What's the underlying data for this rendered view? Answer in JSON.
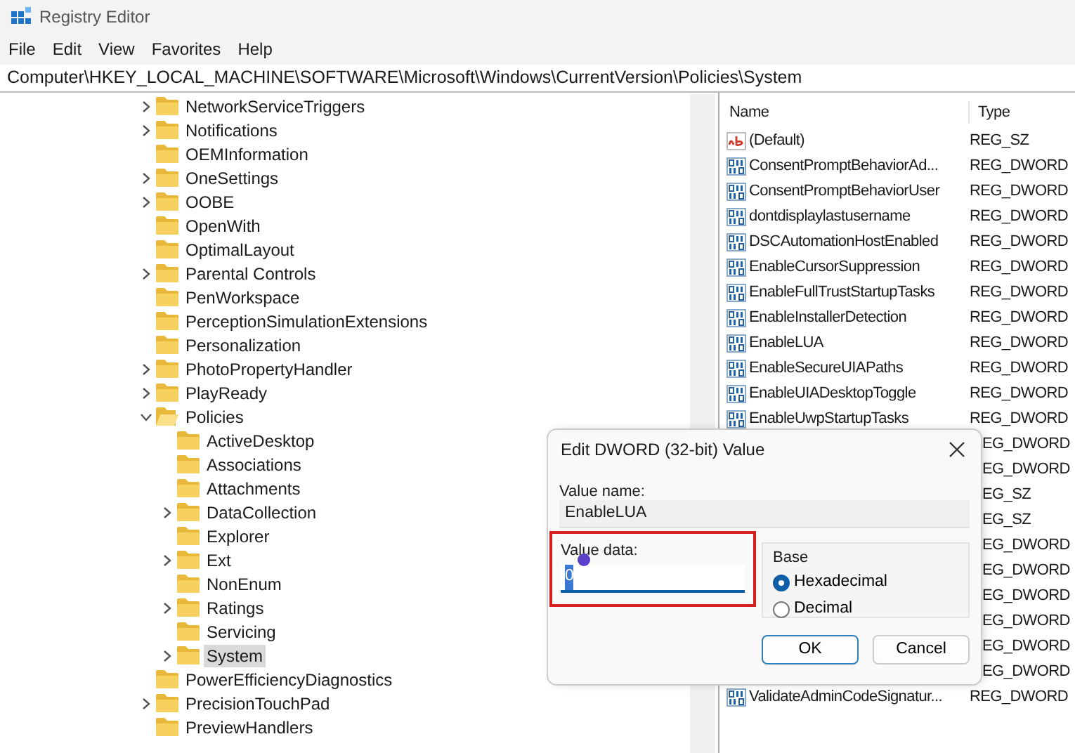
{
  "window": {
    "title": "Registry Editor"
  },
  "menu": [
    "File",
    "Edit",
    "View",
    "Favorites",
    "Help"
  ],
  "address": "Computer\\HKEY_LOCAL_MACHINE\\SOFTWARE\\Microsoft\\Windows\\CurrentVersion\\Policies\\System",
  "tree": [
    {
      "label": "NetworkServiceTriggers",
      "expandable": true,
      "expanded": false,
      "selected": false
    },
    {
      "label": "Notifications",
      "expandable": true,
      "expanded": false,
      "selected": false
    },
    {
      "label": "OEMInformation",
      "expandable": false,
      "expanded": false,
      "selected": false
    },
    {
      "label": "OneSettings",
      "expandable": true,
      "expanded": false,
      "selected": false
    },
    {
      "label": "OOBE",
      "expandable": true,
      "expanded": false,
      "selected": false
    },
    {
      "label": "OpenWith",
      "expandable": false,
      "expanded": false,
      "selected": false
    },
    {
      "label": "OptimalLayout",
      "expandable": false,
      "expanded": false,
      "selected": false
    },
    {
      "label": "Parental Controls",
      "expandable": true,
      "expanded": false,
      "selected": false
    },
    {
      "label": "PenWorkspace",
      "expandable": false,
      "expanded": false,
      "selected": false
    },
    {
      "label": "PerceptionSimulationExtensions",
      "expandable": false,
      "expanded": false,
      "selected": false
    },
    {
      "label": "Personalization",
      "expandable": false,
      "expanded": false,
      "selected": false
    },
    {
      "label": "PhotoPropertyHandler",
      "expandable": true,
      "expanded": false,
      "selected": false
    },
    {
      "label": "PlayReady",
      "expandable": true,
      "expanded": false,
      "selected": false
    },
    {
      "label": "Policies",
      "expandable": true,
      "expanded": true,
      "selected": false,
      "children": [
        {
          "label": "ActiveDesktop",
          "expandable": false,
          "expanded": false,
          "selected": false
        },
        {
          "label": "Associations",
          "expandable": false,
          "expanded": false,
          "selected": false
        },
        {
          "label": "Attachments",
          "expandable": false,
          "expanded": false,
          "selected": false
        },
        {
          "label": "DataCollection",
          "expandable": true,
          "expanded": false,
          "selected": false
        },
        {
          "label": "Explorer",
          "expandable": false,
          "expanded": false,
          "selected": false
        },
        {
          "label": "Ext",
          "expandable": true,
          "expanded": false,
          "selected": false
        },
        {
          "label": "NonEnum",
          "expandable": false,
          "expanded": false,
          "selected": false
        },
        {
          "label": "Ratings",
          "expandable": true,
          "expanded": false,
          "selected": false
        },
        {
          "label": "Servicing",
          "expandable": false,
          "expanded": false,
          "selected": false
        },
        {
          "label": "System",
          "expandable": true,
          "expanded": false,
          "selected": true
        }
      ]
    },
    {
      "label": "PowerEfficiencyDiagnostics",
      "expandable": false,
      "expanded": false,
      "selected": false
    },
    {
      "label": "PrecisionTouchPad",
      "expandable": true,
      "expanded": false,
      "selected": false
    },
    {
      "label": "PreviewHandlers",
      "expandable": false,
      "expanded": false,
      "selected": false
    }
  ],
  "values": {
    "columns": [
      "Name",
      "Type"
    ],
    "rows": [
      {
        "kind": "string",
        "name": "(Default)",
        "type": "REG_SZ"
      },
      {
        "kind": "dword",
        "name": "ConsentPromptBehaviorAd...",
        "type": "REG_DWORD"
      },
      {
        "kind": "dword",
        "name": "ConsentPromptBehaviorUser",
        "type": "REG_DWORD"
      },
      {
        "kind": "dword",
        "name": "dontdisplaylastusername",
        "type": "REG_DWORD"
      },
      {
        "kind": "dword",
        "name": "DSCAutomationHostEnabled",
        "type": "REG_DWORD"
      },
      {
        "kind": "dword",
        "name": "EnableCursorSuppression",
        "type": "REG_DWORD"
      },
      {
        "kind": "dword",
        "name": "EnableFullTrustStartupTasks",
        "type": "REG_DWORD"
      },
      {
        "kind": "dword",
        "name": "EnableInstallerDetection",
        "type": "REG_DWORD"
      },
      {
        "kind": "dword",
        "name": "EnableLUA",
        "type": "REG_DWORD"
      },
      {
        "kind": "dword",
        "name": "EnableSecureUIAPaths",
        "type": "REG_DWORD"
      },
      {
        "kind": "dword",
        "name": "EnableUIADesktopToggle",
        "type": "REG_DWORD"
      },
      {
        "kind": "dword",
        "name": "EnableUwpStartupTasks",
        "type": "REG_DWORD"
      },
      {
        "kind": "covered",
        "type": "EG_DWORD"
      },
      {
        "kind": "covered",
        "type": "EG_DWORD"
      },
      {
        "kind": "covered",
        "type": "EG_SZ"
      },
      {
        "kind": "covered",
        "type": "EG_SZ"
      },
      {
        "kind": "covered",
        "type": "EG_DWORD"
      },
      {
        "kind": "covered",
        "type": "EG_DWORD"
      },
      {
        "kind": "covered",
        "type": "EG_DWORD"
      },
      {
        "kind": "covered",
        "type": "EG_DWORD"
      },
      {
        "kind": "covered",
        "type": "EG_DWORD"
      },
      {
        "kind": "covered",
        "type": "EG_DWORD"
      },
      {
        "kind": "dword",
        "name": "ValidateAdminCodeSignatur...",
        "type": "REG_DWORD"
      }
    ]
  },
  "dialog": {
    "title": "Edit DWORD (32-bit) Value",
    "value_name_label": "Value name:",
    "value_name": "EnableLUA",
    "value_data_label": "Value data:",
    "value_data": "0",
    "value_data_selected": true,
    "base_label": "Base",
    "bases": [
      {
        "label": "Hexadecimal",
        "selected": true
      },
      {
        "label": "Decimal",
        "selected": false
      }
    ],
    "buttons": [
      {
        "label": "OK",
        "default": true
      },
      {
        "label": "Cancel",
        "default": false
      }
    ]
  }
}
